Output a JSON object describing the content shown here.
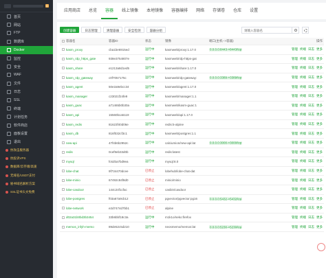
{
  "sidebar": {
    "badge": "0",
    "items": [
      {
        "label": "首页"
      },
      {
        "label": "网站"
      },
      {
        "label": "FTP"
      },
      {
        "label": "数据库"
      },
      {
        "label": "Docker",
        "active": true
      },
      {
        "label": "监控"
      },
      {
        "label": "安全"
      },
      {
        "label": "WAF"
      },
      {
        "label": "文件"
      },
      {
        "label": "日志"
      },
      {
        "label": "SSL"
      },
      {
        "label": "终端"
      },
      {
        "label": "计划任务"
      },
      {
        "label": "软件商店"
      },
      {
        "label": "面板设置"
      },
      {
        "label": "退出"
      }
    ],
    "promos": [
      {
        "label": "抗攻击服务器"
      },
      {
        "label": "抗投诉VPS"
      },
      {
        "label": "数据库/云存储/高速"
      },
      {
        "label": "无域名/USDT支付"
      },
      {
        "label": "秘书域名解析方案"
      },
      {
        "label": "SSL证书头文免费"
      }
    ]
  },
  "top_tabs": [
    {
      "label": "应用商店"
    },
    {
      "label": "总览"
    },
    {
      "label": "容器",
      "active": true
    },
    {
      "label": "线上镜像"
    },
    {
      "label": "本地镜像"
    },
    {
      "label": "容器编排"
    },
    {
      "label": "网络"
    },
    {
      "label": "存储卷"
    },
    {
      "label": "仓库"
    },
    {
      "label": "设置"
    }
  ],
  "toolbar": {
    "buttons": [
      {
        "label": "创建容器",
        "primary": true
      },
      {
        "label": "日志管理"
      },
      {
        "label": "清理容器"
      },
      {
        "label": "安全检测"
      },
      {
        "label": "容器分组"
      }
    ]
  },
  "search": {
    "placeholder": "请输入容器名"
  },
  "table": {
    "headers": {
      "name": "容器名",
      "id": "容器ID",
      "status": "状态",
      "image": "镜像",
      "port": "端口(主机-->容器)",
      "ops": "操作"
    },
    "ops": [
      "管理",
      "终端",
      "日志",
      "更多"
    ],
    "rows": [
      {
        "name": "kasm_proxy",
        "id": "cba1be6915ed",
        "status": "运行中",
        "image": "kasmweb/proxy:1.17.0",
        "port": "0.0.0.0:8443->8443/tcp",
        "running": true
      },
      {
        "name": "kasm_rdp_https_gate",
        "id": "938e3754807e",
        "status": "运行中",
        "image": "kasmweb/rdp-https-gat",
        "port": "",
        "running": true
      },
      {
        "name": "kasm_share",
        "id": "e1213a8d1ed5",
        "status": "运行中",
        "image": "kasmweb/share:1.17.0",
        "port": "",
        "running": true
      },
      {
        "name": "kasm_rdp_gateway",
        "id": "c0f7057175c",
        "status": "运行中",
        "image": "kasmweb/rdp-gateway:",
        "port": "0.0.0.0:3389->3389/tcp",
        "running": true
      },
      {
        "name": "kasm_agent",
        "id": "50e2a9ebcc34",
        "status": "运行中",
        "image": "kasmweb/agent:1.17.0",
        "port": "",
        "running": true
      },
      {
        "name": "kasm_manager",
        "id": "c23021f24fe9",
        "status": "运行中",
        "image": "kasmweb/manager:1.1",
        "port": "",
        "running": true
      },
      {
        "name": "kasm_guac",
        "id": "a71465b0b30a",
        "status": "运行中",
        "image": "kasmweb/kasm-guac:1",
        "port": "",
        "running": true
      },
      {
        "name": "kasm_api",
        "id": "15560bca5119",
        "status": "运行中",
        "image": "kasmweb/api:1.17.0",
        "port": "",
        "running": true
      },
      {
        "name": "kasm_redis",
        "id": "81623f40d06e",
        "status": "运行中",
        "image": "redis:5-alpine",
        "port": "",
        "running": true
      },
      {
        "name": "kasm_db",
        "id": "816f032cf3c1",
        "status": "运行中",
        "image": "kasmweb/postgres:1.1",
        "port": "",
        "running": true
      },
      {
        "name": "new-api",
        "id": "47f4b6b2952c",
        "status": "运行中",
        "image": "calciumion/new-api:lat",
        "port": "0.0.0.0:3000->3000/tcp",
        "running": true
      },
      {
        "name": "redis",
        "id": "0cef9eb33d0b",
        "status": "运行中",
        "image": "redis:latest",
        "port": "",
        "running": true
      },
      {
        "name": "mysql",
        "id": "fc62ba7bd9ea",
        "status": "运行中",
        "image": "mysql:8.0",
        "port": "",
        "running": true
      },
      {
        "name": "lobe-chat",
        "id": "9f734470dcee",
        "status": "已停止",
        "image": "lobehub/lobe-chat-dat",
        "port": "",
        "running": false
      },
      {
        "name": "lobe-minio",
        "id": "67492c84f8d0",
        "status": "已停止",
        "image": "minio/minio",
        "port": "",
        "running": false
      },
      {
        "name": "lobe-casdoor",
        "id": "144c24f1cfac",
        "status": "已停止",
        "image": "casbin/casdoor",
        "port": "",
        "running": false
      },
      {
        "name": "lobe-postgres",
        "id": "f03a67a9cb12",
        "status": "已停止",
        "image": "pgvector/pgvector:pg16",
        "port": "0.0.0.0:5432->5432/tcp",
        "running": false
      },
      {
        "name": "lobe-network",
        "id": "e2d7474d7bb1",
        "status": "已停止",
        "image": "alpine",
        "port": "",
        "running": false
      },
      {
        "name": "d02a31b0bd3b3454",
        "id": "33b6bbf18c3a",
        "status": "运行中",
        "image": "m1k1o/neko:firefox",
        "port": "",
        "running": true
      },
      {
        "name": "memos_infyh-memo",
        "id": "89de52c5d210",
        "status": "运行中",
        "image": "neosmemo/memos:lat",
        "port": "0.0.0.0:5230->5230/tcp",
        "running": true
      }
    ]
  }
}
